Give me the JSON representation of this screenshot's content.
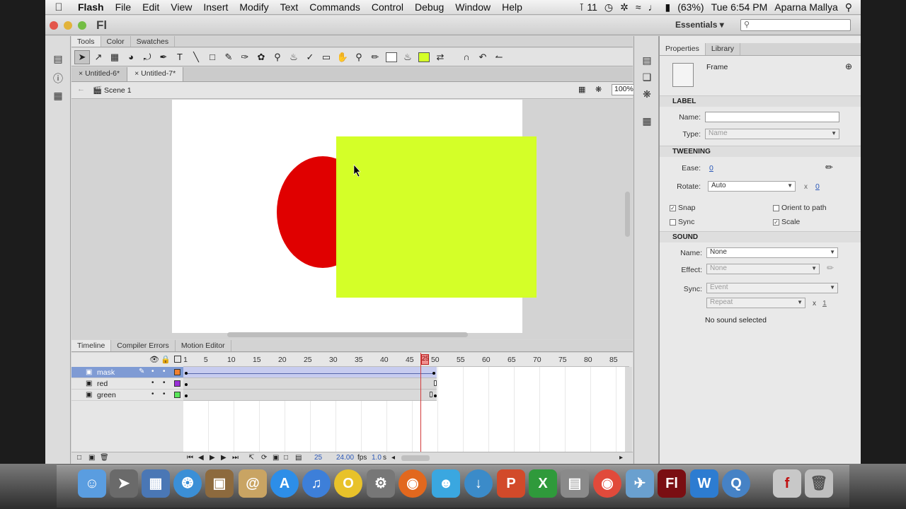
{
  "menubar": {
    "app_name": "Flash",
    "items": [
      "File",
      "Edit",
      "View",
      "Insert",
      "Modify",
      "Text",
      "Commands",
      "Control",
      "Debug",
      "Window",
      "Help"
    ],
    "status_adobe": "11",
    "battery": "(63%)",
    "clock": "Tue 6:54 PM",
    "user": "Aparna Mallya"
  },
  "titlebar": {
    "logo": "Fl",
    "workspace": "Essentials",
    "search_placeholder": ""
  },
  "panels_top": {
    "tabs": [
      "Tools",
      "Color",
      "Swatches"
    ]
  },
  "documents": {
    "tabs": [
      "Untitled-6*",
      "Untitled-7*"
    ],
    "active": 1
  },
  "editbar": {
    "scene": "Scene 1",
    "zoom": "100%"
  },
  "stage": {
    "red_color": "#e00000",
    "green_color": "#d4ff28",
    "stage_color": "#ffffff"
  },
  "timeline": {
    "tabs": [
      "Timeline",
      "Compiler Errors",
      "Motion Editor"
    ],
    "frame_numbers": [
      "1",
      "5",
      "10",
      "15",
      "20",
      "25",
      "30",
      "35",
      "40",
      "45",
      "50",
      "55",
      "60",
      "65",
      "70",
      "75",
      "80",
      "85"
    ],
    "layers": [
      {
        "name": "mask",
        "color": "#f08030"
      },
      {
        "name": "red",
        "color": "#9a30d8"
      },
      {
        "name": "green",
        "color": "#59e65a"
      }
    ],
    "current_frame": "25",
    "fps": "24.00",
    "fps_unit": "fps",
    "time": "1.0",
    "time_unit": "s",
    "playhead_label": "25"
  },
  "properties": {
    "tabs": [
      "Properties",
      "Library"
    ],
    "type": "Frame",
    "label_section": "LABEL",
    "name_label": "Name:",
    "name_value": "",
    "type_label": "Type:",
    "type_value": "Name",
    "tweening_section": "TWEENING",
    "ease_label": "Ease:",
    "ease_value": "0",
    "rotate_label": "Rotate:",
    "rotate_value": "Auto",
    "rotate_times": "x",
    "rotate_count": "0",
    "snap": "Snap",
    "orient": "Orient to path",
    "sync_chk": "Sync",
    "scale": "Scale",
    "sound_section": "SOUND",
    "sname_label": "Name:",
    "sname_value": "None",
    "effect_label": "Effect:",
    "effect_value": "None",
    "sync_label": "Sync:",
    "sync_value": "Event",
    "repeat_value": "Repeat",
    "repeat_times": "x",
    "repeat_count": "1",
    "no_sound": "No sound selected"
  }
}
